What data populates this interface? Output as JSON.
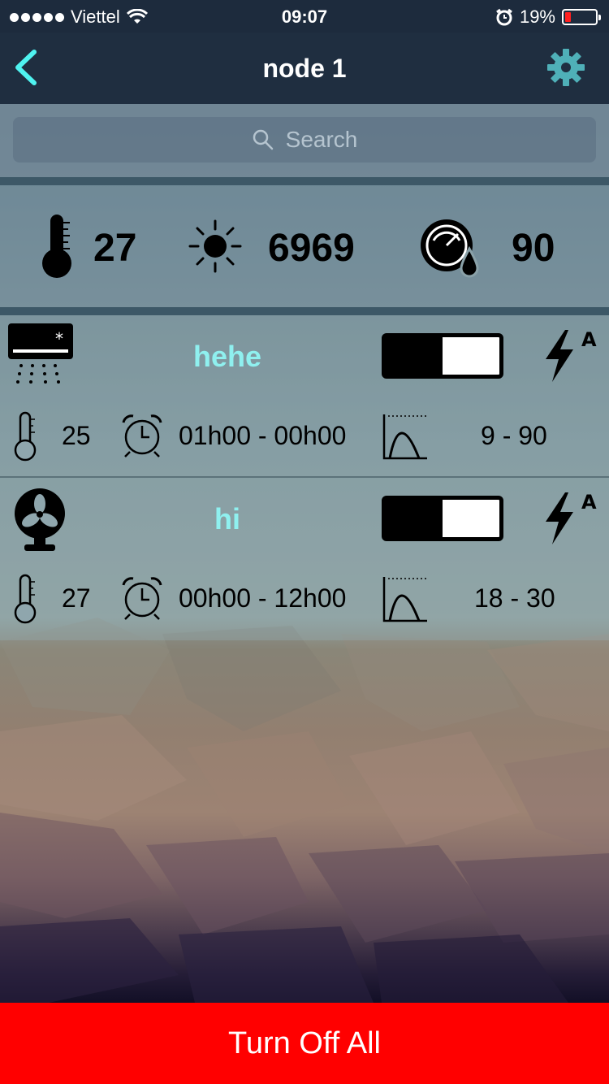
{
  "status_bar": {
    "carrier": "Viettel",
    "time": "09:07",
    "battery_percent_text": "19%",
    "battery_level": 0.19
  },
  "nav": {
    "title": "node 1",
    "back_icon": "chevron-left-icon",
    "settings_icon": "gear-icon"
  },
  "search": {
    "placeholder": "Search"
  },
  "sensors": {
    "temperature": "27",
    "light": "6969",
    "humidity": "90"
  },
  "devices": [
    {
      "name": "hehe",
      "icon": "air-conditioner-icon",
      "temperature": "25",
      "schedule": "01h00 - 00h00",
      "range": "9 - 90",
      "toggle_on": false,
      "auto_label": "A"
    },
    {
      "name": "hi",
      "icon": "fan-icon",
      "temperature": "27",
      "schedule": "00h00 - 12h00",
      "range": "18 - 30",
      "toggle_on": false,
      "auto_label": "A"
    }
  ],
  "actions": {
    "turn_off_all": "Turn Off All"
  },
  "colors": {
    "accent": "#4ff3f0",
    "device_name": "#8ff0ef",
    "danger": "#ff0000",
    "nav_bg": "#1f2e40"
  }
}
